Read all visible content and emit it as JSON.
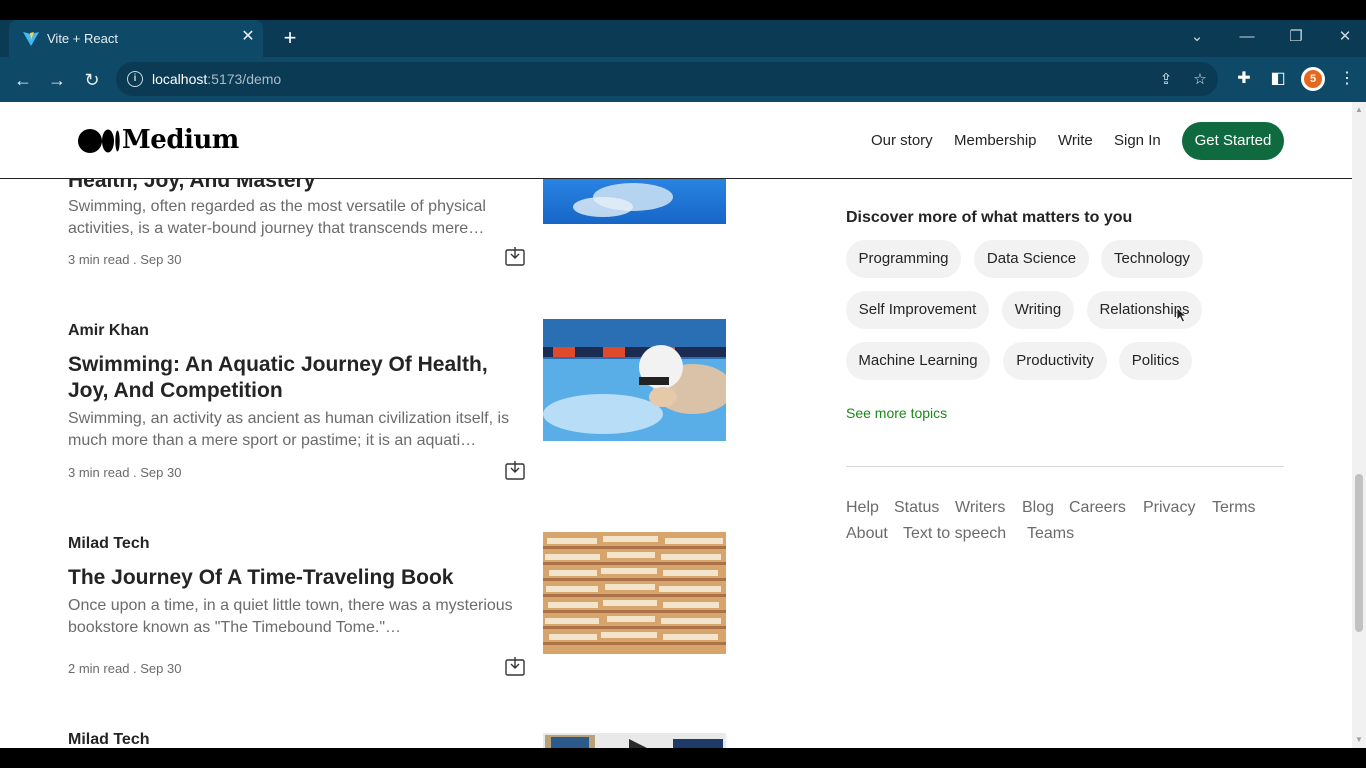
{
  "browser": {
    "tab_title": "Vite + React",
    "url_host": "localhost",
    "url_path": ":5173/demo"
  },
  "header": {
    "logo_text": "Medium",
    "nav": [
      "Our story",
      "Membership",
      "Write",
      "Sign In"
    ],
    "cta": "Get Started"
  },
  "articles": [
    {
      "title": "Health, Joy, And Mastery",
      "excerpt": "Swimming, often regarded as the most versatile of physical activities, is a water-bound journey that transcends mere…",
      "meta": "3 min read . Sep 30"
    },
    {
      "author": "Amir Khan",
      "title": "Swimming: An Aquatic Journey Of Health, Joy, And Competition",
      "excerpt": "Swimming, an activity as ancient as human civilization itself, is much more than a mere sport or pastime; it is an aquati…",
      "meta": "3 min read . Sep 30"
    },
    {
      "author": "Milad Tech",
      "title": "The Journey Of A Time-Traveling Book",
      "excerpt": "Once upon a time, in a quiet little town, there was a mysterious bookstore known as \"The Timebound Tome.\"…",
      "meta": "2 min read . Sep 30"
    },
    {
      "author": "Milad Tech"
    }
  ],
  "sidebar": {
    "heading": "Discover more of what matters to you",
    "topics": [
      "Programming",
      "Data Science",
      "Technology",
      "Self Improvement",
      "Writing",
      "Relationships",
      "Machine Learning",
      "Productivity",
      "Politics"
    ],
    "see_more": "See more topics",
    "footer_links": [
      "Help",
      "Status",
      "Writers",
      "Blog",
      "Careers",
      "Privacy",
      "Terms",
      "About",
      "Text to speech",
      "Teams"
    ]
  },
  "colors": {
    "brand_green": "#0f6b3f",
    "link_green": "#1a8917",
    "chrome_blue": "#0e4968"
  }
}
